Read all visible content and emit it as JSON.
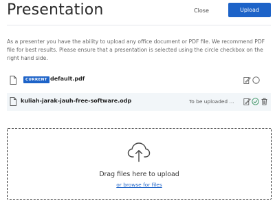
{
  "header": {
    "title": "Presentation",
    "close_label": "Close",
    "upload_label": "Upload"
  },
  "description": "As a presenter you have the ability to upload any office document or PDF file. We recommend PDF file for best results. Please ensure that a presentation is selected using the circle checkbox on the right hand side.",
  "files": [
    {
      "badge": "CURRENT",
      "name": "default.pdf",
      "status": "",
      "icon": "document-icon",
      "actions": [
        "edit-icon",
        "radio-circle-icon"
      ]
    },
    {
      "badge": "",
      "name": "kuliah-jarak-jauh-free-software.odp",
      "status": "To be uploaded ...",
      "icon": "document-icon",
      "actions": [
        "edit-icon",
        "check-circle-icon",
        "trash-icon"
      ]
    }
  ],
  "dropzone": {
    "title": "Drag files here to upload",
    "browse_link": "or browse for files",
    "icon": "cloud-upload-icon"
  },
  "colors": {
    "accent": "#1d63c8",
    "success": "#2e8b57",
    "row_highlight": "#f2f6f9"
  }
}
